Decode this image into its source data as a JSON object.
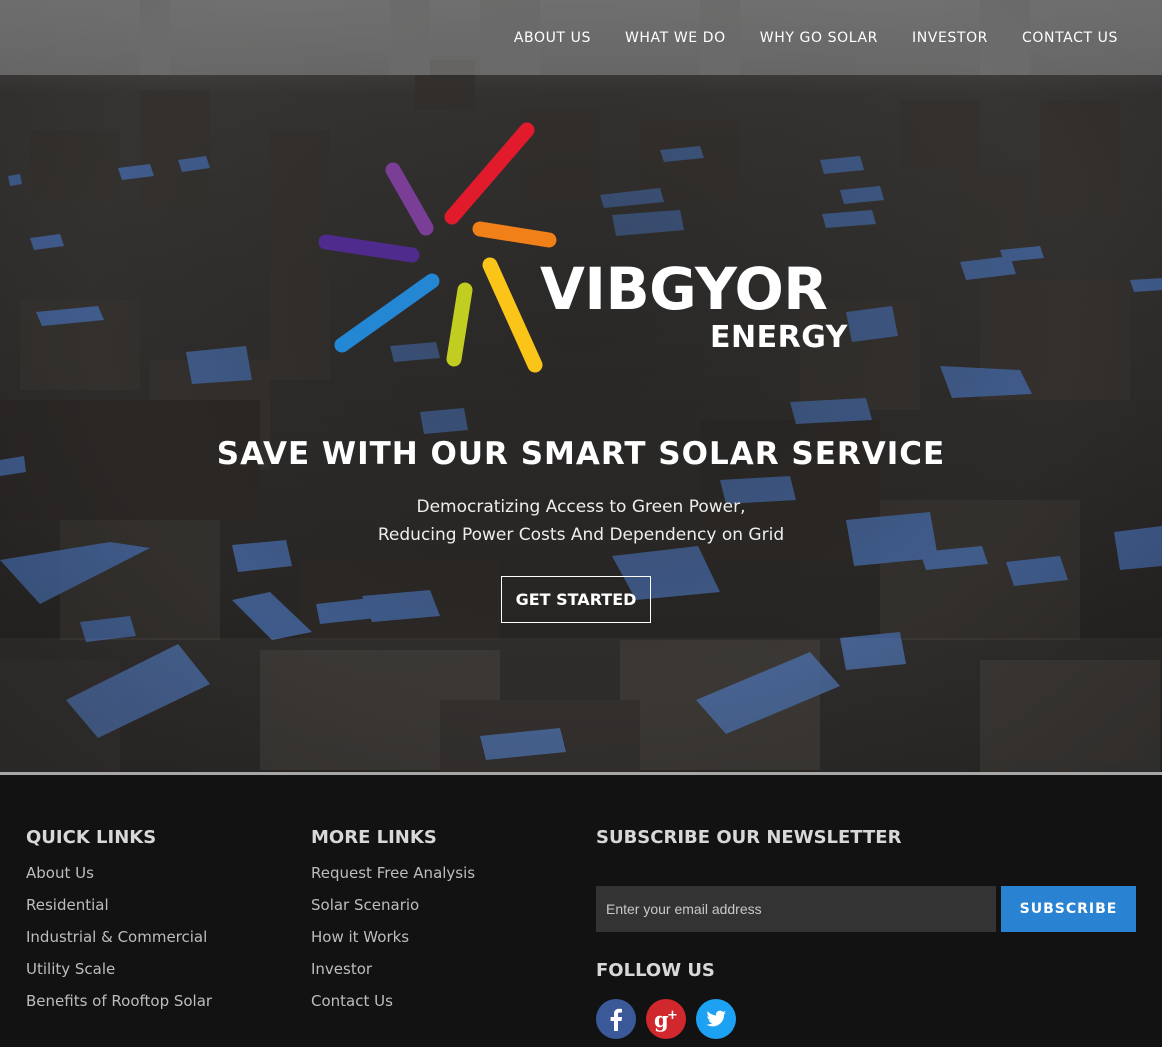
{
  "nav": {
    "items": [
      {
        "label": "ABOUT US"
      },
      {
        "label": "WHAT WE DO"
      },
      {
        "label": "WHY GO SOLAR"
      },
      {
        "label": "INVESTOR"
      },
      {
        "label": "CONTACT US"
      }
    ]
  },
  "logo": {
    "name": "VIBGYOR",
    "sub": "ENERGY",
    "ray_colors": [
      "#e21b2c",
      "#f08017",
      "#fbc419",
      "#c2cd22",
      "#2387d4",
      "#4f2b8e",
      "#7a3e96"
    ]
  },
  "hero": {
    "title": "SAVE WITH OUR SMART SOLAR SERVICE",
    "subtitle_line1": "Democratizing Access to Green Power,",
    "subtitle_line2": "Reducing Power Costs And Dependency on Grid",
    "cta_label": "GET STARTED"
  },
  "footer": {
    "quick_links": {
      "title": "QUICK LINKS",
      "items": [
        "About Us",
        "Residential",
        "Industrial & Commercial",
        "Utility Scale",
        "Benefits of Rooftop Solar"
      ]
    },
    "more_links": {
      "title": "MORE LINKS",
      "items": [
        "Request Free Analysis",
        "Solar Scenario",
        "How it Works",
        "Investor",
        "Contact Us"
      ]
    },
    "newsletter": {
      "title": "SUBSCRIBE OUR NEWSLETTER",
      "email_placeholder": "Enter your email address",
      "button_label": "SUBSCRIBE"
    },
    "follow": {
      "title": "FOLLOW US",
      "icons": [
        "facebook-icon",
        "google-plus-icon",
        "twitter-icon"
      ]
    }
  },
  "colors": {
    "accent_blue": "#2a82d2",
    "facebook": "#3b5998",
    "google_plus": "#d0282c",
    "twitter": "#1da1f2"
  }
}
